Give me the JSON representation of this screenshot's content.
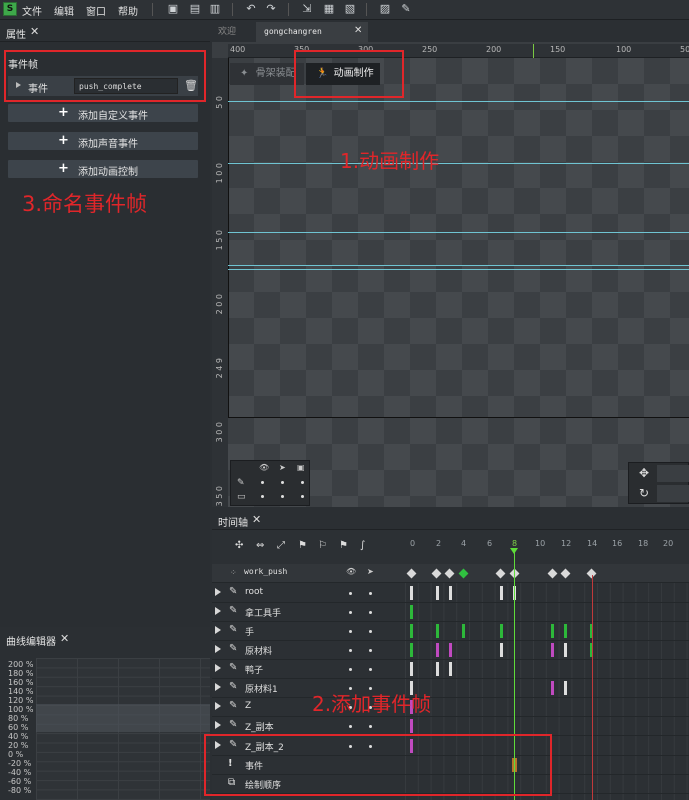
{
  "menu": [
    "文件",
    "编辑",
    "窗口",
    "帮助"
  ],
  "properties_panel": {
    "title": "属性",
    "section": "事件帧",
    "event_label": "事件",
    "event_value": "push_complete",
    "buttons": [
      "添加自定义事件",
      "添加声音事件",
      "添加动画控制"
    ]
  },
  "stage": {
    "tabs": [
      "欢迎",
      "gongchangren"
    ],
    "ruler_top": [
      "400",
      "350",
      "300",
      "250",
      "200",
      "150",
      "100",
      "50"
    ],
    "ruler_left": [
      "5 0",
      "1 0 0",
      "1 5 0",
      "2 0 0",
      "2 4 9",
      "3 0 0",
      "3 5 0"
    ],
    "mode_skeleton": "骨架装配",
    "mode_animate": "动画制作"
  },
  "annotations": {
    "step1": "1.动画制作",
    "step2": "2.添加事件帧",
    "step3": "3.命名事件帧"
  },
  "timeline": {
    "title": "时间轴",
    "frames": [
      "0",
      "2",
      "4",
      "6",
      "8",
      "10",
      "12",
      "14",
      "16",
      "18",
      "20"
    ],
    "animation_name": "work_push",
    "layers": [
      "root",
      "拿工具手",
      "手",
      "原材料",
      "鸭子",
      "原材料1",
      "Z",
      "Z_副本",
      "Z_副本_2"
    ],
    "event_row": "事件",
    "draw_order_row": "绘制顺序"
  },
  "curve_editor": {
    "title": "曲线编辑器",
    "labels": [
      "200 %",
      "180 %",
      "160 %",
      "140 %",
      "120 %",
      "100 %",
      "80 %",
      "60 %",
      "40 %",
      "20 %",
      "0 %",
      "-20 %",
      "-40 %",
      "-60 %",
      "-80 %"
    ]
  }
}
